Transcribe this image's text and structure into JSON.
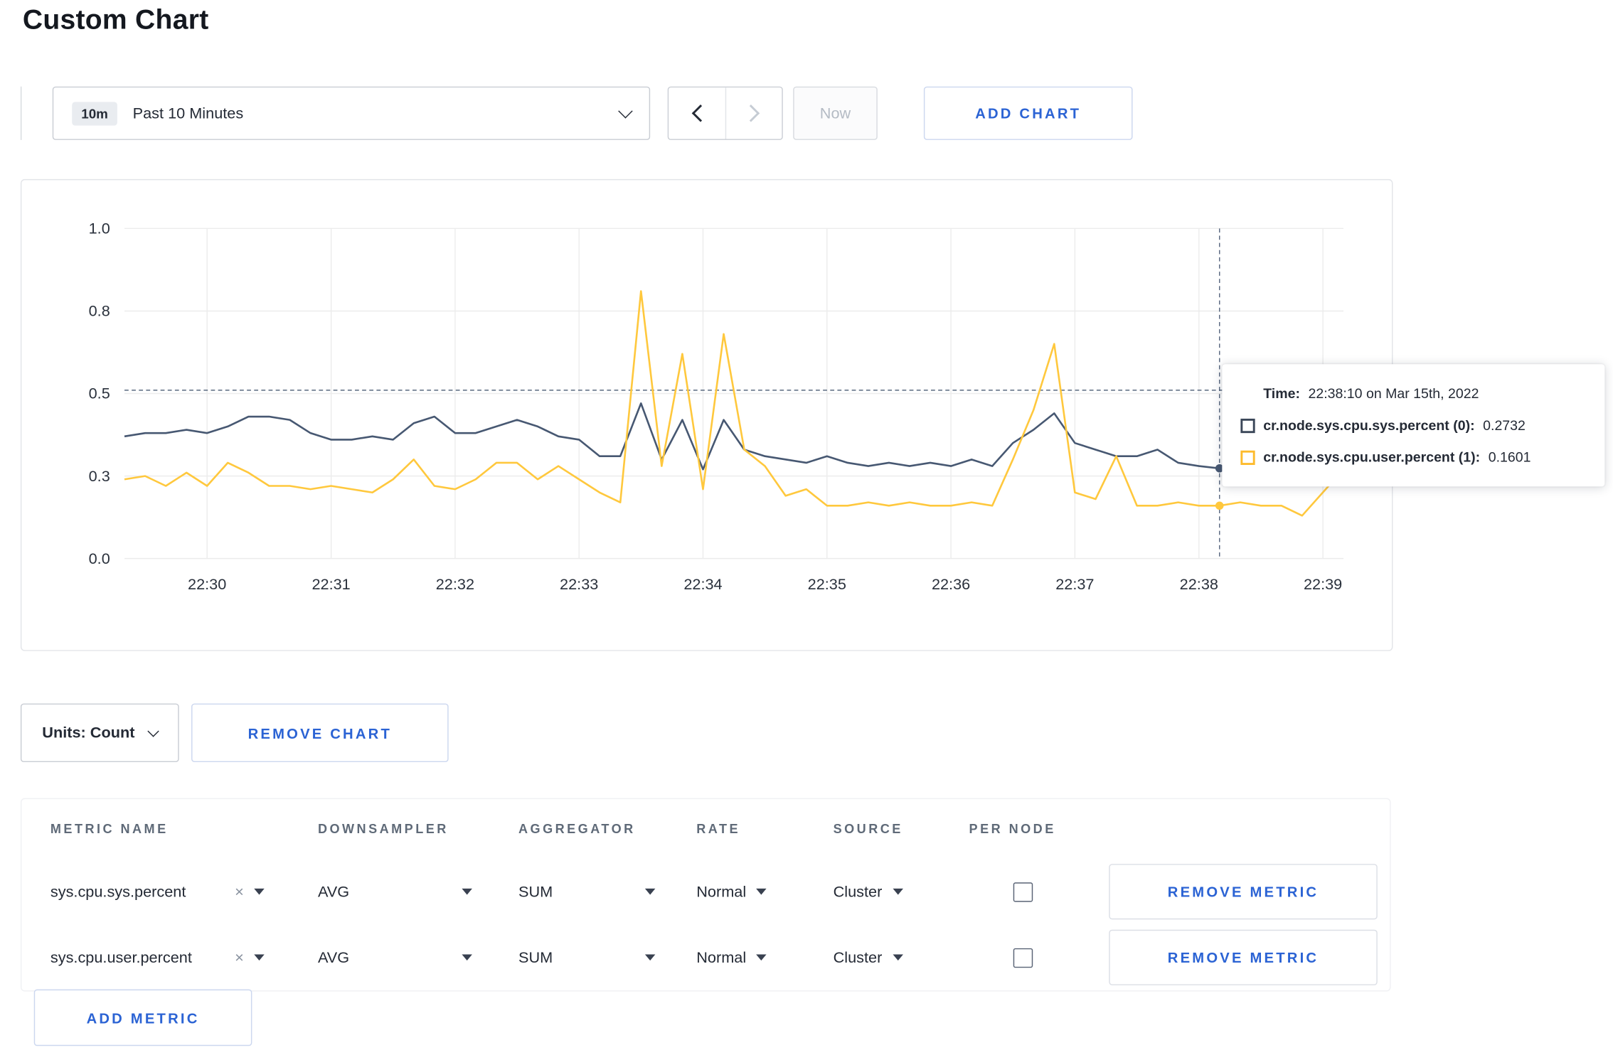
{
  "page": {
    "title": "Custom Chart"
  },
  "colors": {
    "accent": "#2b63d4",
    "series_sys": "#475872",
    "series_user": "#ffc83d"
  },
  "toolbar": {
    "time_badge": "10m",
    "time_label": "Past 10 Minutes",
    "now_label": "Now",
    "add_chart_label": "ADD CHART"
  },
  "chart_data": {
    "type": "line",
    "title": "",
    "xlabel": "",
    "ylabel": "",
    "ylim": [
      0,
      1
    ],
    "grid": true,
    "y_ticks": [
      {
        "label": "0.0",
        "value": 0
      },
      {
        "label": "0.3",
        "value": 0.25
      },
      {
        "label": "0.5",
        "value": 0.5
      },
      {
        "label": "0.8",
        "value": 0.75
      },
      {
        "label": "1.0",
        "value": 1.0
      }
    ],
    "x_ticks": [
      {
        "label": "22:30",
        "frac": 0.0678
      },
      {
        "label": "22:31",
        "frac": 0.1695
      },
      {
        "label": "22:32",
        "frac": 0.2712
      },
      {
        "label": "22:33",
        "frac": 0.3729
      },
      {
        "label": "22:34",
        "frac": 0.4746
      },
      {
        "label": "22:35",
        "frac": 0.5763
      },
      {
        "label": "22:36",
        "frac": 0.678
      },
      {
        "label": "22:37",
        "frac": 0.7797
      },
      {
        "label": "22:38",
        "frac": 0.8814
      },
      {
        "label": "22:39",
        "frac": 0.9831
      }
    ],
    "series": [
      {
        "name": "cr.node.sys.cpu.sys.percent",
        "color": "#475872",
        "values": [
          0.37,
          0.38,
          0.38,
          0.39,
          0.38,
          0.4,
          0.43,
          0.43,
          0.42,
          0.38,
          0.36,
          0.36,
          0.37,
          0.36,
          0.41,
          0.43,
          0.38,
          0.38,
          0.4,
          0.42,
          0.4,
          0.37,
          0.36,
          0.31,
          0.31,
          0.47,
          0.3,
          0.42,
          0.27,
          0.42,
          0.33,
          0.31,
          0.3,
          0.29,
          0.31,
          0.29,
          0.28,
          0.29,
          0.28,
          0.29,
          0.28,
          0.3,
          0.28,
          0.35,
          0.39,
          0.44,
          0.35,
          0.33,
          0.31,
          0.31,
          0.33,
          0.29,
          0.28,
          0.2732,
          0.32,
          0.3,
          0.31,
          0.3,
          0.31,
          0.3
        ]
      },
      {
        "name": "cr.node.sys.cpu.user.percent",
        "color": "#ffc83d",
        "values": [
          0.24,
          0.25,
          0.22,
          0.26,
          0.22,
          0.29,
          0.26,
          0.22,
          0.22,
          0.21,
          0.22,
          0.21,
          0.2,
          0.24,
          0.3,
          0.22,
          0.21,
          0.24,
          0.29,
          0.29,
          0.24,
          0.28,
          0.24,
          0.2,
          0.17,
          0.81,
          0.28,
          0.62,
          0.21,
          0.68,
          0.33,
          0.28,
          0.19,
          0.21,
          0.16,
          0.16,
          0.17,
          0.16,
          0.17,
          0.16,
          0.16,
          0.17,
          0.16,
          0.3,
          0.45,
          0.65,
          0.2,
          0.18,
          0.31,
          0.16,
          0.16,
          0.17,
          0.16,
          0.1601,
          0.17,
          0.16,
          0.16,
          0.13,
          0.2,
          0.27
        ]
      }
    ],
    "crosshair": {
      "frac": 0.8983,
      "hline_value": 0.51,
      "dots": [
        {
          "series": 0,
          "value": 0.2732
        },
        {
          "series": 1,
          "value": 0.1601
        }
      ]
    }
  },
  "tooltip": {
    "time_label": "Time:",
    "time_value": "22:38:10 on Mar 15th, 2022",
    "entries": [
      {
        "label": "cr.node.sys.cpu.sys.percent (0):",
        "value": "0.2732",
        "color": "#3a4658"
      },
      {
        "label": "cr.node.sys.cpu.user.percent (1):",
        "value": "0.1601",
        "color": "#fdbb2d"
      }
    ]
  },
  "chart_controls": {
    "units_label": "Units: Count",
    "remove_chart_label": "REMOVE CHART",
    "add_metric_label": "ADD METRIC"
  },
  "metrics_table": {
    "headers": [
      "METRIC NAME",
      "DOWNSAMPLER",
      "AGGREGATOR",
      "RATE",
      "SOURCE",
      "PER NODE"
    ],
    "rows": [
      {
        "metric": "sys.cpu.sys.percent",
        "downsampler": "AVG",
        "aggregator": "SUM",
        "rate": "Normal",
        "source": "Cluster",
        "per_node": false,
        "remove_label": "REMOVE METRIC"
      },
      {
        "metric": "sys.cpu.user.percent",
        "downsampler": "AVG",
        "aggregator": "SUM",
        "rate": "Normal",
        "source": "Cluster",
        "per_node": false,
        "remove_label": "REMOVE METRIC"
      }
    ]
  }
}
